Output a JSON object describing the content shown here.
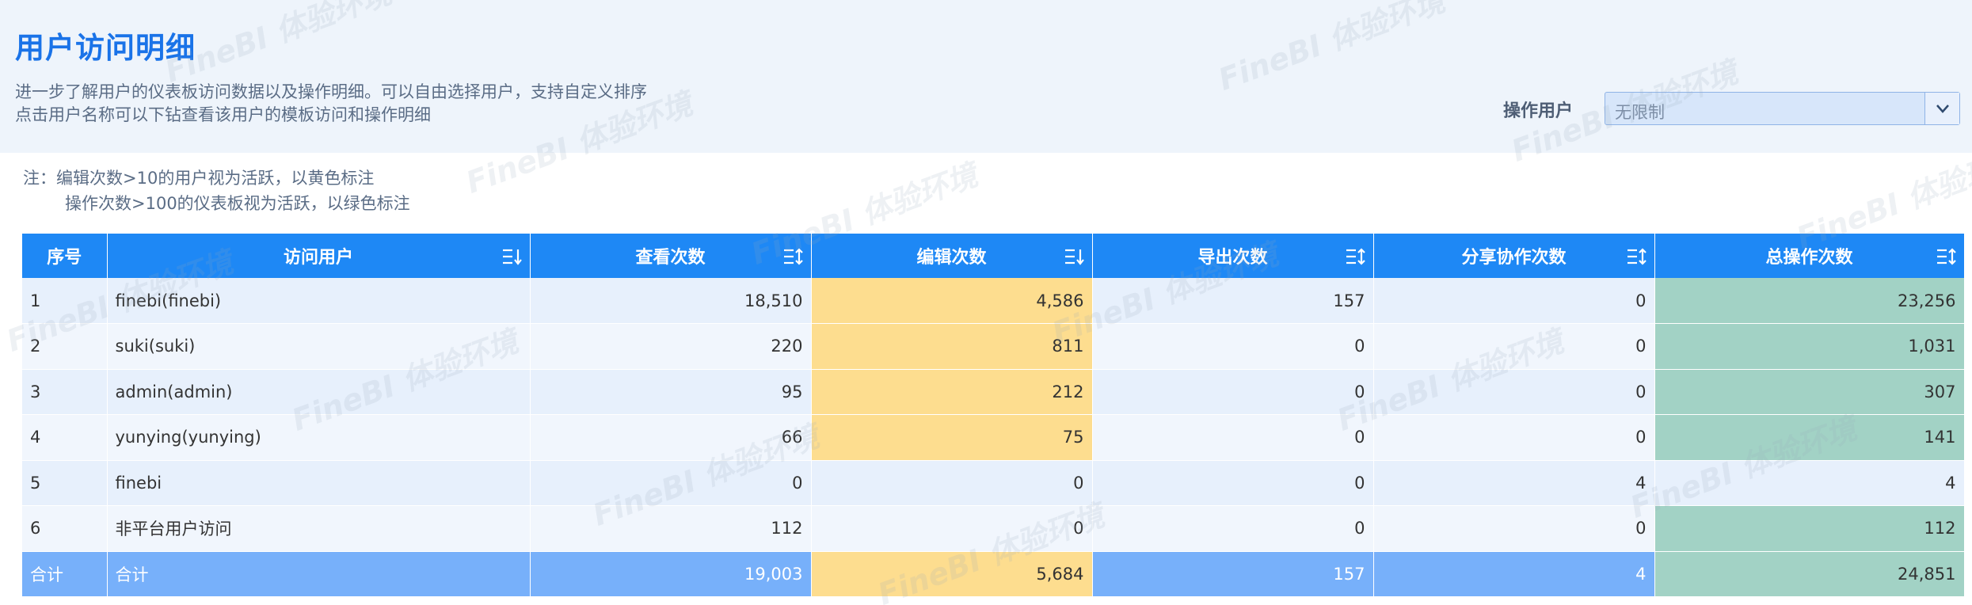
{
  "page": {
    "title": "用户访问明细",
    "desc_line1": "进一步了解用户的仪表板访问数据以及操作明细。可以自由选择用户，支持自定义排序",
    "desc_line2": "点击用户名称可以下钻查看该用户的模板访问和操作明细",
    "watermark": "FineBI 体验环境"
  },
  "filter": {
    "label": "操作用户",
    "value": "无限制"
  },
  "notes": {
    "line1": "注：编辑次数>10的用户视为活跃，以黄色标注",
    "line2": "操作次数>100的仪表板视为活跃，以绿色标注"
  },
  "colors": {
    "header_blue": "#1e88f5",
    "active_yellow": "#fddd8f",
    "active_green": "#a2d2c5",
    "total_row": "#77b0fa"
  },
  "table": {
    "columns": [
      "序号",
      "访问用户",
      "查看次数",
      "编辑次数",
      "导出次数",
      "分享协作次数",
      "总操作次数"
    ],
    "rows": [
      {
        "idx": "1",
        "user": "finebi(finebi)",
        "view": "18,510",
        "edit": "4,586",
        "export": "157",
        "share": "0",
        "total": "23,256"
      },
      {
        "idx": "2",
        "user": "suki(suki)",
        "view": "220",
        "edit": "811",
        "export": "0",
        "share": "0",
        "total": "1,031"
      },
      {
        "idx": "3",
        "user": "admin(admin)",
        "view": "95",
        "edit": "212",
        "export": "0",
        "share": "0",
        "total": "307"
      },
      {
        "idx": "4",
        "user": "yunying(yunying)",
        "view": "66",
        "edit": "75",
        "export": "0",
        "share": "0",
        "total": "141"
      },
      {
        "idx": "5",
        "user": "finebi",
        "view": "0",
        "edit": "0",
        "export": "0",
        "share": "4",
        "total": "4"
      },
      {
        "idx": "6",
        "user": "非平台用户访问",
        "view": "112",
        "edit": "0",
        "export": "0",
        "share": "0",
        "total": "112"
      }
    ],
    "total": {
      "idx": "合计",
      "user": "合计",
      "view": "19,003",
      "edit": "5,684",
      "export": "157",
      "share": "4",
      "total": "24,851"
    }
  }
}
